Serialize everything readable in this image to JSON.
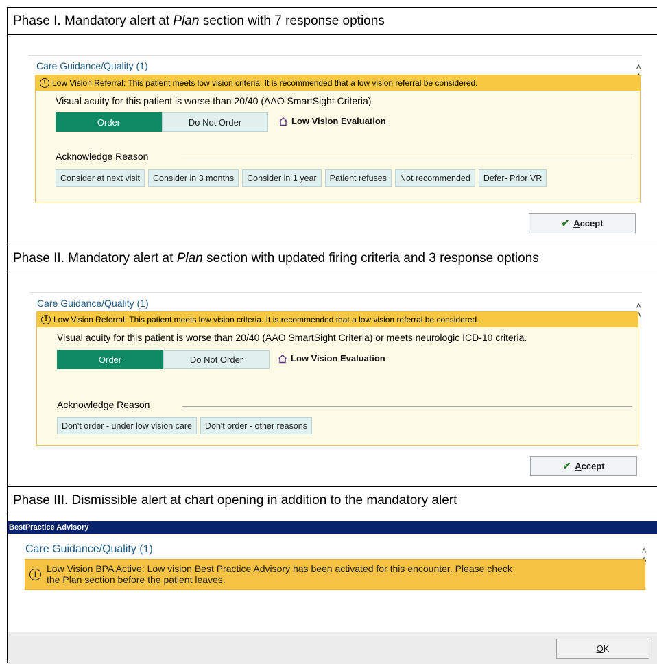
{
  "phase1": {
    "title_pre": "Phase I. Mandatory alert at ",
    "title_em": "Plan",
    "title_post": " section with 7 response options",
    "section_title": "Care Guidance/Quality (1)",
    "alert_text": "Low Vision Referral: This patient meets low vision criteria. It is recommended that a low vision referral be considered.",
    "criteria": "Visual acuity for this patient is worse than 20/40 (AAO SmartSight Criteria)",
    "order_label": "Order",
    "do_not_order_label": "Do Not Order",
    "evaluation_label": "Low Vision Evaluation",
    "ack_label": "Acknowledge Reason",
    "reasons": [
      "Consider at next visit",
      "Consider in 3 months",
      "Consider in 1 year",
      "Patient refuses",
      "Not recommended",
      "Defer- Prior VR"
    ],
    "accept_first": "A",
    "accept_rest": "ccept"
  },
  "phase2": {
    "title_pre": "Phase II. Mandatory alert at ",
    "title_em": "Plan",
    "title_post": " section with updated firing criteria and 3 response options",
    "section_title": "Care Guidance/Quality (1)",
    "alert_text": "Low Vision Referral: This patient meets low vision criteria. It is recommended that a low vision referral be considered.",
    "criteria": "Visual acuity for this patient is worse than 20/40 (AAO SmartSight Criteria) or meets neurologic ICD-10 criteria.",
    "order_label": "Order",
    "do_not_order_label": "Do Not Order",
    "evaluation_label": "Low Vision Evaluation",
    "ack_label": "Acknowledge Reason",
    "reasons": [
      "Don't order - under low vision care",
      "Don't order - other reasons"
    ],
    "accept_first": "A",
    "accept_rest": "ccept"
  },
  "phase3": {
    "title": "Phase III. Dismissible alert at chart opening in addition to the mandatory alert",
    "window_title": "BestPractice Advisory",
    "section_title": "Care Guidance/Quality (1)",
    "alert_line1": "Low Vision BPA Active: Low vision Best Practice Advisory has been activated for this encounter. Please check",
    "alert_line2": "the Plan section before the patient leaves.",
    "ok_first": "O",
    "ok_rest": "K"
  },
  "icons": {
    "alert": "exclamation-circle-icon",
    "collapse": "double-chevron-up-icon",
    "evaluation": "house-icon",
    "accept": "checkmark-icon"
  },
  "colors": {
    "alert_header": "#f7c942",
    "order_green": "#0d8a63",
    "reason_bg": "#dff0ef",
    "bpa_bar": "#08236b",
    "section_title": "#1f5b86"
  }
}
